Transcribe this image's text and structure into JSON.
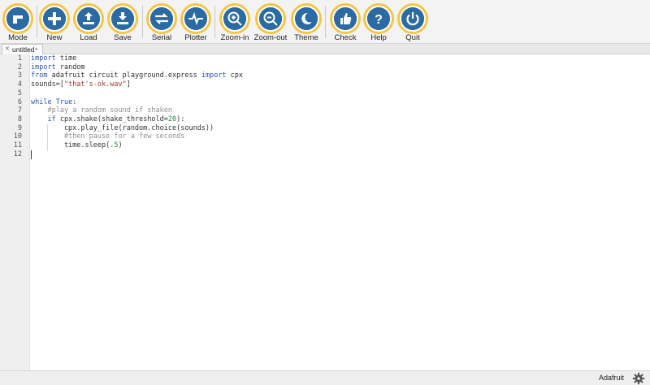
{
  "toolbar": {
    "buttons": [
      {
        "label": "Mode",
        "icon": "mode-icon"
      },
      {
        "label": "New",
        "icon": "plus-icon"
      },
      {
        "label": "Load",
        "icon": "upload-icon"
      },
      {
        "label": "Save",
        "icon": "download-icon"
      },
      {
        "label": "Serial",
        "icon": "serial-arrows-icon"
      },
      {
        "label": "Plotter",
        "icon": "pulse-icon"
      },
      {
        "label": "Zoom-in",
        "icon": "zoom-in-icon"
      },
      {
        "label": "Zoom-out",
        "icon": "zoom-out-icon"
      },
      {
        "label": "Theme",
        "icon": "moon-icon"
      },
      {
        "label": "Check",
        "icon": "thumbs-up-icon"
      },
      {
        "label": "Help",
        "icon": "question-icon"
      },
      {
        "label": "Quit",
        "icon": "power-icon"
      }
    ],
    "accent_ring": "#f6c544",
    "icon_fill": "#2b6aa3"
  },
  "tabs": [
    {
      "label": "untitled",
      "modified_marker": "*",
      "close_glyph": "✕"
    }
  ],
  "editor": {
    "line_numbers": [
      "1",
      "2",
      "3",
      "4",
      "5",
      "6",
      "7",
      "8",
      "9",
      "10",
      "11",
      "12"
    ],
    "lines": [
      "import time",
      "import random",
      "from adafruit circuit playground.express import cpx",
      "sounds=[\"that's-ok.wav\"]",
      "",
      "while True:",
      "    #play a random sound if shaken",
      "    if cpx.shake(shake_threshold=20):",
      "        cpx.play_file(random.choice(sounds))",
      "        #then pause for a few seconds",
      "        time.sleep(.5)",
      ""
    ]
  },
  "statusbar": {
    "mode": "Adafruit",
    "settings_icon": "gear-icon"
  }
}
